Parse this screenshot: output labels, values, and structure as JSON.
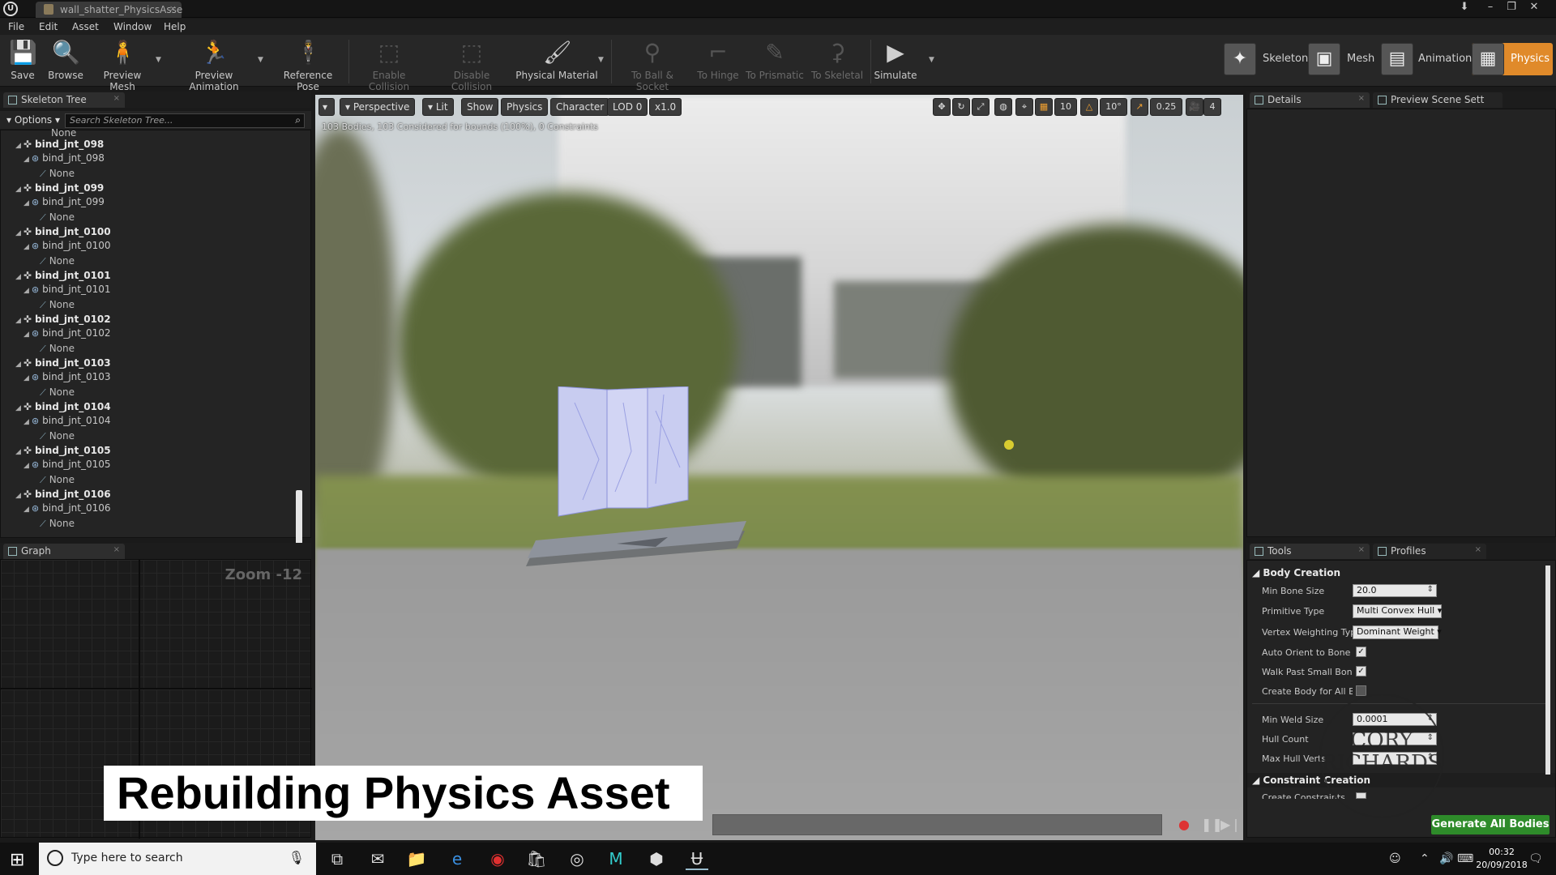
{
  "window": {
    "tab_title": "wall_shatter_PhysicsAsse",
    "logo_letter": "U"
  },
  "menu": [
    "File",
    "Edit",
    "Asset",
    "Window",
    "Help"
  ],
  "toolbar": {
    "buttons": [
      {
        "label": "Save",
        "icon": "save-icon"
      },
      {
        "label": "Browse",
        "icon": "browse-icon"
      },
      {
        "label": "Preview Mesh",
        "icon": "preview-mesh-icon"
      },
      {
        "label": "Preview Animation",
        "icon": "preview-animation-icon"
      },
      {
        "label": "Reference Pose",
        "icon": "reference-pose-icon"
      },
      {
        "label": "Enable Collision",
        "icon": "enable-collision-icon"
      },
      {
        "label": "Disable Collision",
        "icon": "disable-collision-icon"
      },
      {
        "label": "Physical Material",
        "icon": "physical-material-icon"
      },
      {
        "label": "To Ball & Socket",
        "icon": "ball-socket-icon"
      },
      {
        "label": "To Hinge",
        "icon": "hinge-icon"
      },
      {
        "label": "To Prismatic",
        "icon": "prismatic-icon"
      },
      {
        "label": "To Skeletal",
        "icon": "skeletal-icon"
      },
      {
        "label": "Simulate",
        "icon": "simulate-icon"
      }
    ],
    "modes": [
      {
        "label": "Skeleton",
        "active": false
      },
      {
        "label": "Mesh",
        "active": false
      },
      {
        "label": "Animation",
        "active": false
      },
      {
        "label": "Physics",
        "active": true
      }
    ]
  },
  "skeleton_tree": {
    "tab": "Skeleton Tree",
    "options_label": "Options",
    "search_placeholder": "Search Skeleton Tree...",
    "top_none": "None",
    "bones": [
      {
        "bone": "bind_jnt_098",
        "body": "bind_jnt_098",
        "constraint": "None"
      },
      {
        "bone": "bind_jnt_099",
        "body": "bind_jnt_099",
        "constraint": "None"
      },
      {
        "bone": "bind_jnt_0100",
        "body": "bind_jnt_0100",
        "constraint": "None"
      },
      {
        "bone": "bind_jnt_0101",
        "body": "bind_jnt_0101",
        "constraint": "None"
      },
      {
        "bone": "bind_jnt_0102",
        "body": "bind_jnt_0102",
        "constraint": "None"
      },
      {
        "bone": "bind_jnt_0103",
        "body": "bind_jnt_0103",
        "constraint": "None"
      },
      {
        "bone": "bind_jnt_0104",
        "body": "bind_jnt_0104",
        "constraint": "None"
      },
      {
        "bone": "bind_jnt_0105",
        "body": "bind_jnt_0105",
        "constraint": "None"
      },
      {
        "bone": "bind_jnt_0106",
        "body": "bind_jnt_0106",
        "constraint": "None"
      }
    ]
  },
  "graph": {
    "tab": "Graph",
    "zoom": "Zoom -12"
  },
  "viewport": {
    "buttons": [
      "Perspective",
      "Lit",
      "Show",
      "Physics",
      "Character",
      "LOD 0",
      "x1.0"
    ],
    "stats": "103 Bodies, 103 Considered for bounds (100%), 0 Constraints",
    "grid_snap": "10",
    "rot_snap": "10°",
    "scale_snap": "0.25",
    "cam_speed": "4"
  },
  "caption": "Rebuilding Physics Asset",
  "details": {
    "tab": "Details",
    "tab2": "Preview Scene Sett"
  },
  "tools": {
    "tab": "Tools",
    "tab2": "Profiles",
    "body_creation": "Body Creation",
    "min_bone_size_label": "Min Bone Size",
    "min_bone_size": "20.0",
    "primitive_type_label": "Primitive Type",
    "primitive_type": "Multi Convex Hull",
    "vertex_weighting_label": "Vertex Weighting Type",
    "vertex_weighting": "Dominant Weight",
    "auto_orient_label": "Auto Orient to Bone",
    "walk_past_label": "Walk Past Small Bones",
    "create_body_label": "Create Body for All Bones",
    "min_weld_label": "Min Weld Size",
    "min_weld": "0.0001",
    "hull_count_label": "Hull Count",
    "max_hull_label": "Max Hull Verts",
    "constraint_creation": "Constraint Creation",
    "create_constraints_label": "Create Constraints",
    "generate_button": "Generate All Bodies"
  },
  "watermark": {
    "line1": "CORY",
    "line2": "RICHARDS"
  },
  "taskbar": {
    "search_placeholder": "Type here to search",
    "time": "00:32",
    "date": "20/09/2018"
  },
  "colors": {
    "accent": "#e08a2a",
    "generate": "#2e8b2a"
  }
}
